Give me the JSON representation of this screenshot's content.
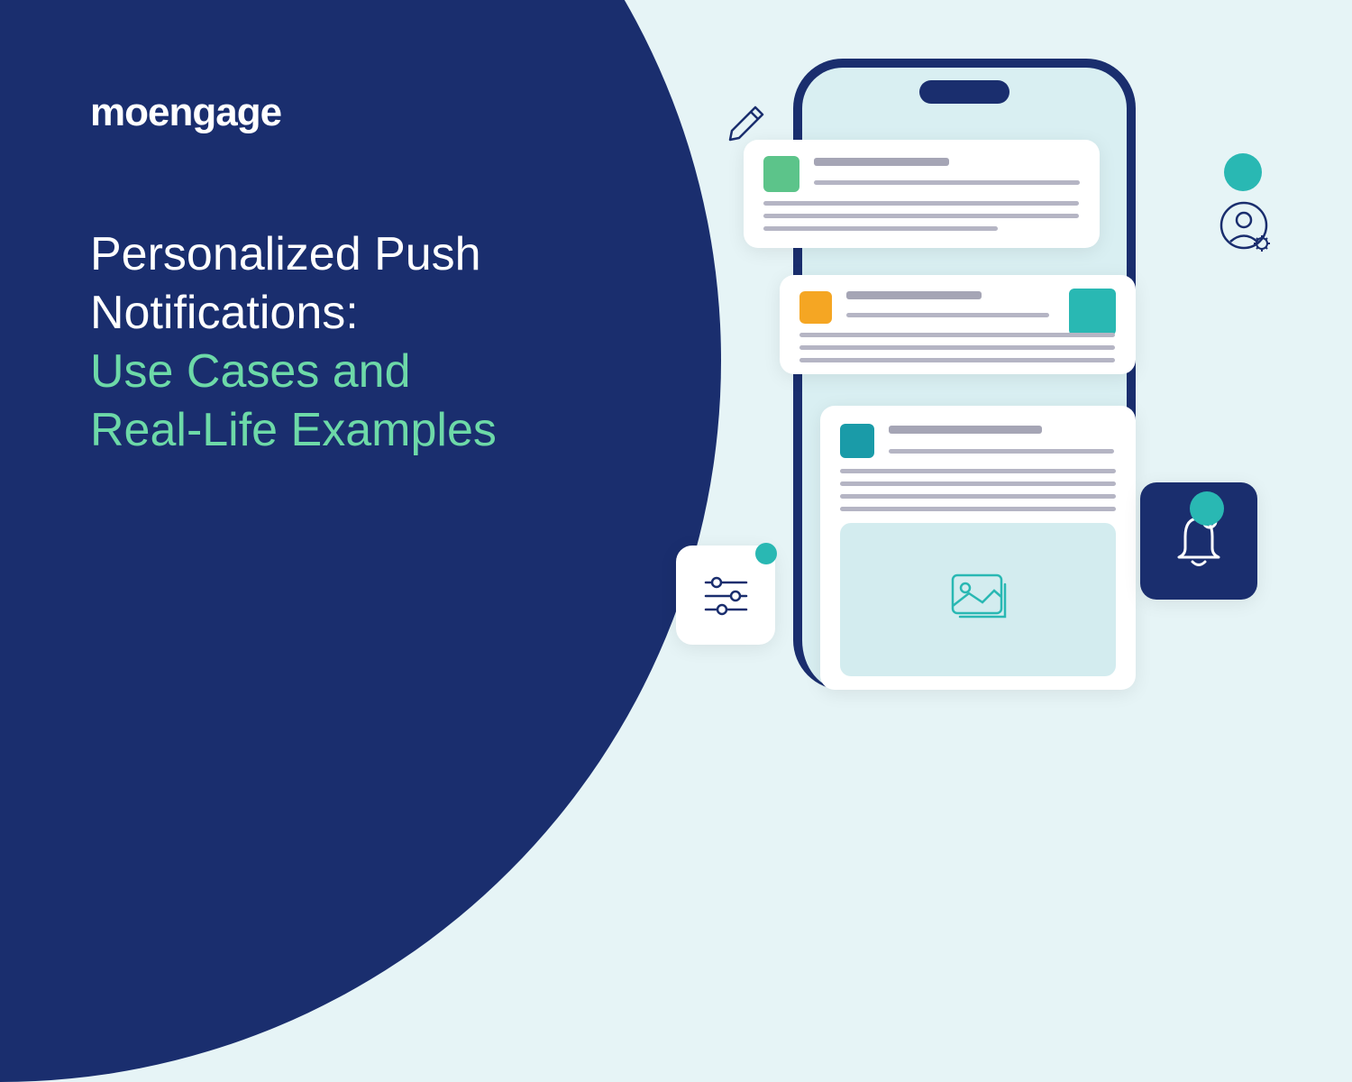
{
  "brand": "moengage",
  "title_line1": "Personalized Push",
  "title_line2": "Notifications:",
  "title_line3": "Use Cases and",
  "title_line4": "Real-Life Examples"
}
